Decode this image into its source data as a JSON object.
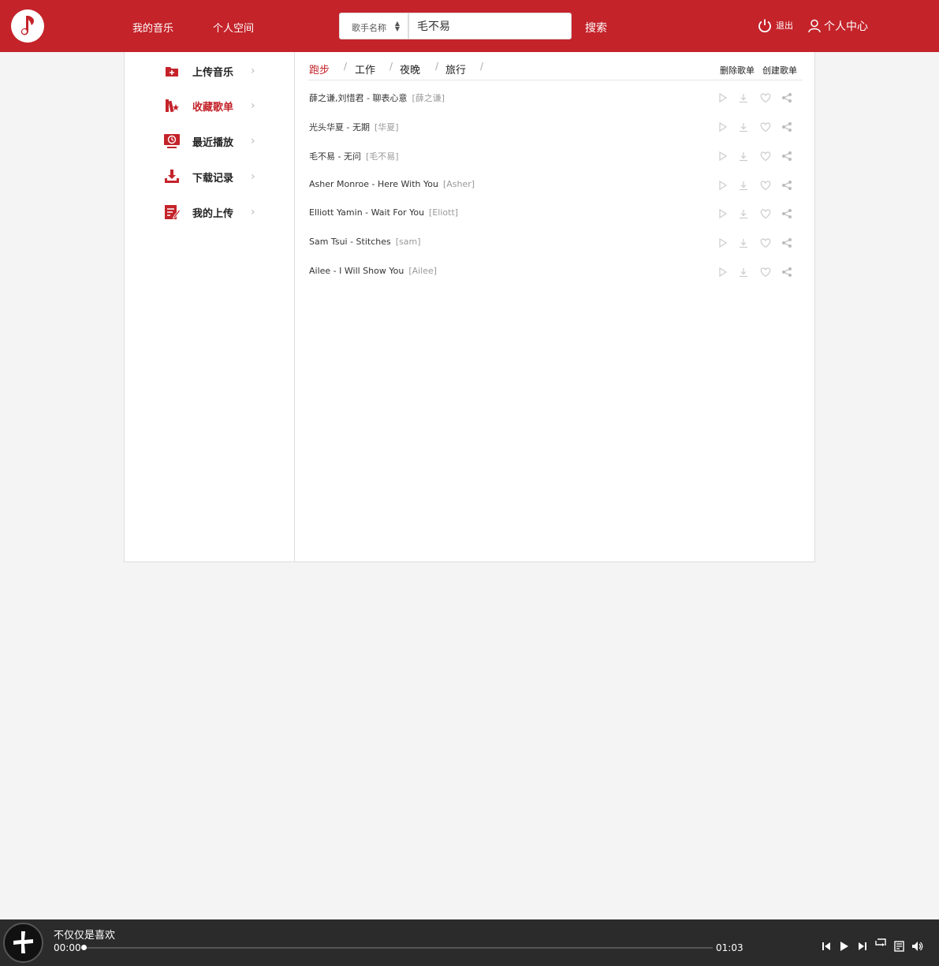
{
  "header": {
    "nav": [
      "我的音乐",
      "个人空间"
    ],
    "search_type": "歌手名称",
    "search_value": "毛不易",
    "search_button": "搜索",
    "logout": "退出",
    "user_center": "个人中心"
  },
  "sidebar": {
    "items": [
      {
        "label": "上传音乐",
        "icon": "upload-folder-icon",
        "active": false
      },
      {
        "label": "收藏歌单",
        "icon": "favorite-playlist-icon",
        "active": true
      },
      {
        "label": "最近播放",
        "icon": "recent-play-icon",
        "active": false
      },
      {
        "label": "下载记录",
        "icon": "download-icon",
        "active": false
      },
      {
        "label": "我的上传",
        "icon": "my-upload-icon",
        "active": false
      }
    ]
  },
  "playlist": {
    "tabs": [
      "跑步",
      "工作",
      "夜晚",
      "旅行"
    ],
    "active_tab": 0,
    "delete_label": "删除歌单",
    "create_label": "创建歌单",
    "songs": [
      {
        "title": "薛之谦,刘惜君 - 聊表心意",
        "artist": "[薛之谦]"
      },
      {
        "title": "光头华夏 - 无期",
        "artist": "[华夏]"
      },
      {
        "title": "毛不易 - 无问",
        "artist": "[毛不易]"
      },
      {
        "title": "Asher Monroe - Here With You",
        "artist": "[Asher]"
      },
      {
        "title": "Elliott Yamin - Wait For You",
        "artist": "[Eliott]"
      },
      {
        "title": "Sam Tsui - Stitches",
        "artist": "[sam]"
      },
      {
        "title": "Ailee - I Will Show You",
        "artist": "[Ailee]"
      }
    ]
  },
  "player": {
    "title": "不仅仅是喜欢",
    "current_time": "00:00",
    "total_time": "01:03",
    "progress": 0
  },
  "colors": {
    "brand": "#c4232a",
    "player_bg": "#2b2b2b",
    "page_bg": "#f4f4f4"
  }
}
